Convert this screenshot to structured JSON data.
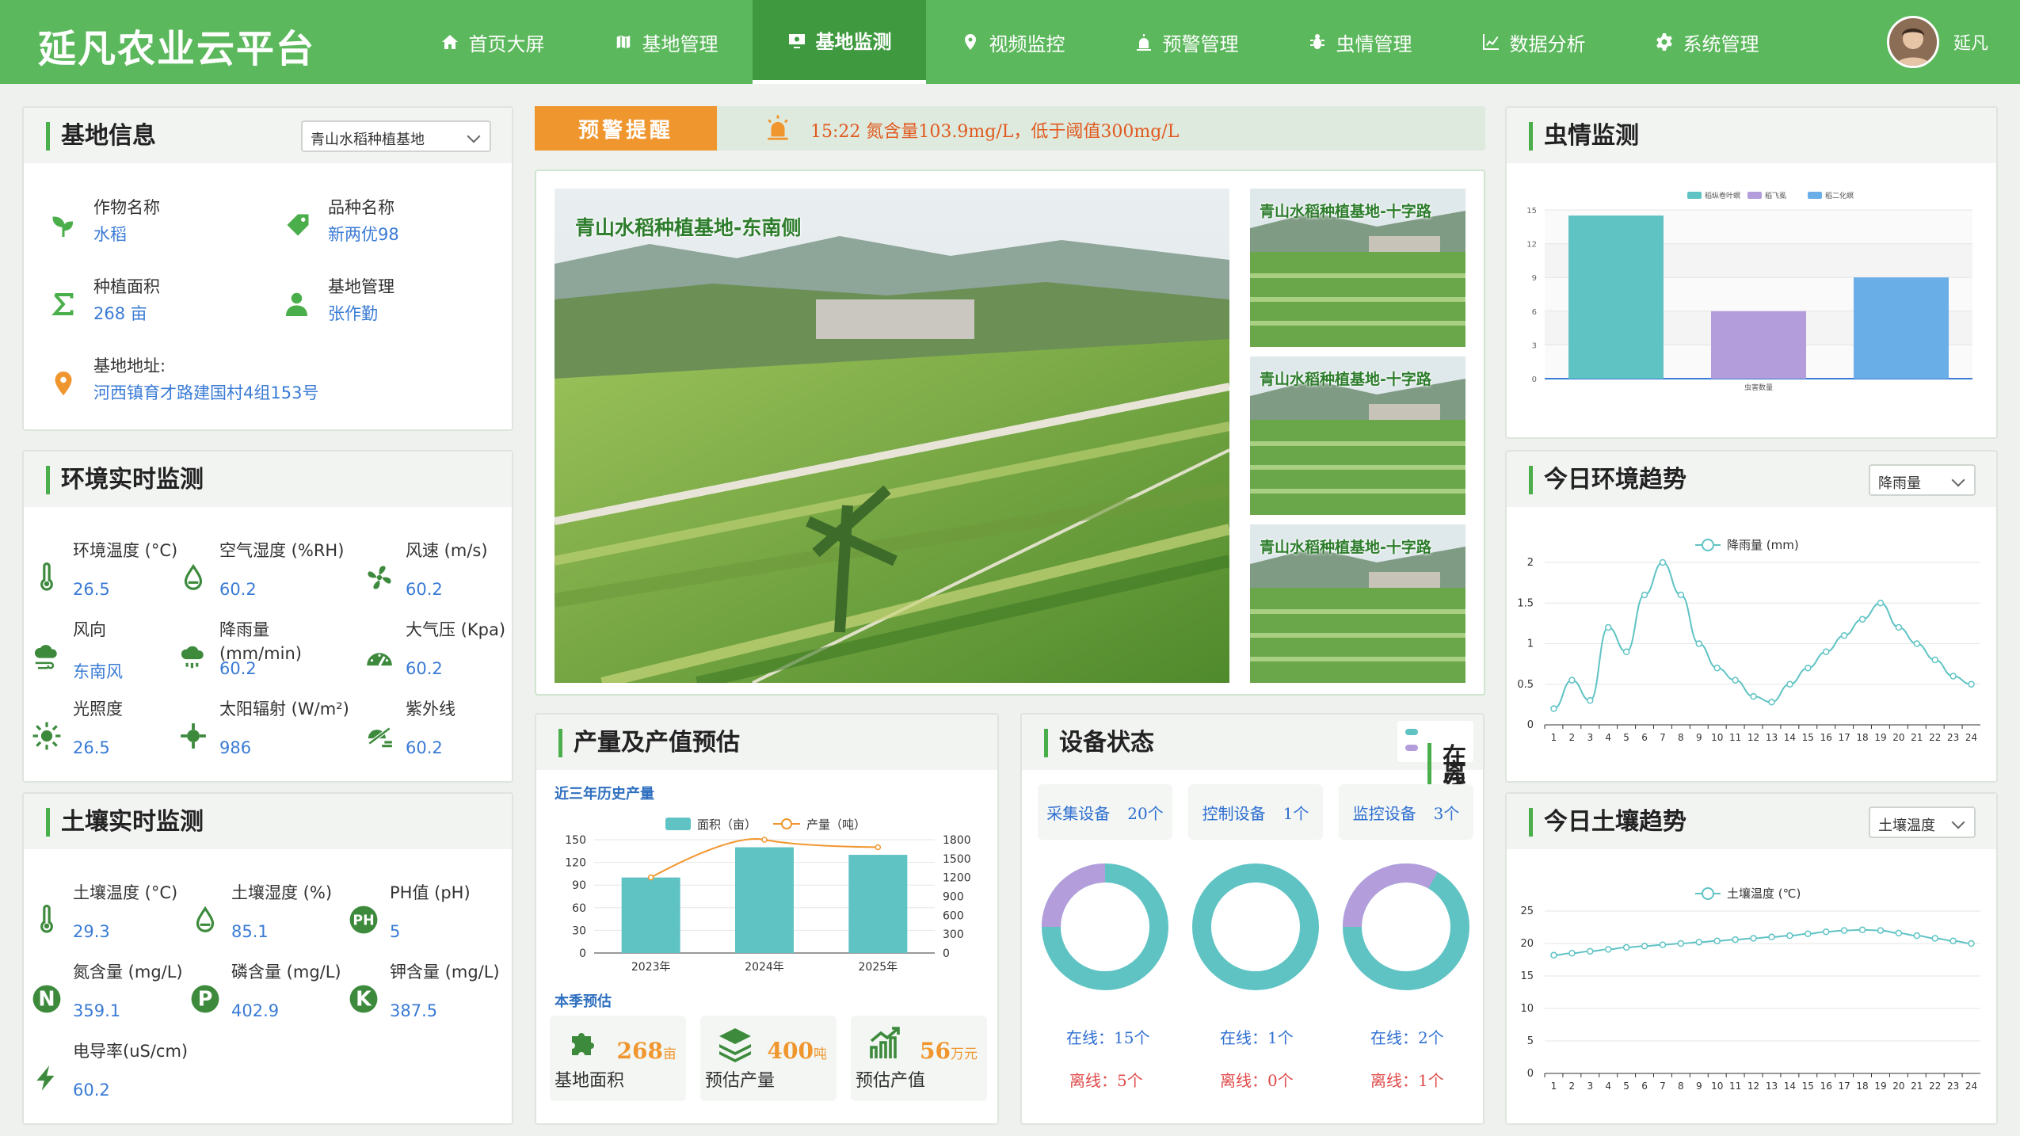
{
  "header": {
    "logo": "延凡农业云平台",
    "nav": [
      {
        "label": "首页大屏",
        "icon": "home-icon",
        "active": false
      },
      {
        "label": "基地管理",
        "icon": "map-icon",
        "active": false
      },
      {
        "label": "基地监测",
        "icon": "monitor-icon",
        "active": true
      },
      {
        "label": "视频监控",
        "icon": "location-pin-icon",
        "active": false
      },
      {
        "label": "预警管理",
        "icon": "alarm-icon",
        "active": false
      },
      {
        "label": "虫情管理",
        "icon": "bug-icon",
        "active": false
      },
      {
        "label": "数据分析",
        "icon": "chart-icon",
        "active": false
      },
      {
        "label": "系统管理",
        "icon": "gear-icon",
        "active": false
      }
    ],
    "user_name": "延凡"
  },
  "base_info": {
    "title": "基地信息",
    "selected_base": "青山水稻种植基地",
    "crop_label": "作物名称",
    "crop_value": "水稻",
    "variety_label": "品种名称",
    "variety_value": "新两优98",
    "area_label": "种植面积",
    "area_value": "268 亩",
    "manager_label": "基地管理",
    "manager_value": "张作勤",
    "address_label": "基地地址:",
    "address_value": "河西镇育才路建国村4组153号"
  },
  "env_realtime": {
    "title": "环境实时监测",
    "items": [
      {
        "label": "环境温度 (°C)",
        "value": "26.5",
        "icon": "thermometer-icon"
      },
      {
        "label": "空气湿度 (%RH)",
        "value": "60.2",
        "icon": "humidity-drop-icon"
      },
      {
        "label": "风速 (m/s)",
        "value": "60.2",
        "icon": "fan-icon"
      },
      {
        "label": "风向",
        "value": "东南风",
        "icon": "wind-cloud-icon"
      },
      {
        "label": "降雨量 (mm/min)",
        "value": "60.2",
        "icon": "rain-cloud-icon"
      },
      {
        "label": "大气压 (Kpa)",
        "value": "60.2",
        "icon": "gauge-icon"
      },
      {
        "label": "光照度",
        "value": "26.5",
        "icon": "sun-icon"
      },
      {
        "label": "太阳辐射 (W/m²)",
        "value": "986",
        "icon": "radiation-icon"
      },
      {
        "label": "紫外线",
        "value": "60.2",
        "icon": "uv-icon"
      }
    ]
  },
  "soil_realtime": {
    "title": "土壤实时监测",
    "items": [
      {
        "label": "土壤温度 (°C)",
        "value": "29.3",
        "icon": "thermometer-icon"
      },
      {
        "label": "土壤湿度 (%)",
        "value": "85.1",
        "icon": "humidity-drop-icon"
      },
      {
        "label": "PH值 (pH)",
        "value": "5",
        "icon": "ph-icon",
        "badge": "PH"
      },
      {
        "label": "氮含量 (mg/L)",
        "value": "359.1",
        "icon": "nitrogen-icon",
        "badge": "N"
      },
      {
        "label": "磷含量 (mg/L)",
        "value": "402.9",
        "icon": "phosphorus-icon",
        "badge": "P"
      },
      {
        "label": "钾含量 (mg/L)",
        "value": "387.5",
        "icon": "potassium-icon",
        "badge": "K"
      },
      {
        "label": "电导率(uS/cm)",
        "value": "60.2",
        "icon": "lightning-icon"
      }
    ]
  },
  "warning": {
    "tag": "预警提醒",
    "text": "15:22   氮含量103.9mg/L，低于阈值300mg/L"
  },
  "cameras": {
    "main_label": "青山水稻种植基地-东南侧",
    "side": [
      {
        "label": "青山水稻种植基地-十字路"
      },
      {
        "label": "青山水稻种植基地-十字路"
      },
      {
        "label": "青山水稻种植基地-十字路"
      }
    ]
  },
  "yield": {
    "title": "产量及产值预估",
    "history_label": "近三年历史产量",
    "season_label": "本季预估",
    "estimates": [
      {
        "num": "268",
        "unit": "亩",
        "name": "基地面积",
        "icon": "puzzle-icon"
      },
      {
        "num": "400",
        "unit": "吨",
        "name": "预估产量",
        "icon": "layers-icon"
      },
      {
        "num": "56",
        "unit": "万元",
        "name": "预估产值",
        "icon": "growth-chart-icon"
      }
    ]
  },
  "devices": {
    "title": "设备状态",
    "legend_online": "在线",
    "legend_offline": "离线",
    "online_color": "#5fc3c4",
    "offline_color": "#b39ddb",
    "groups": [
      {
        "name": "采集设备",
        "total": "20个",
        "online": 15,
        "offline": 5,
        "online_text": "在线：15个",
        "offline_text": "离线：5个"
      },
      {
        "name": "控制设备",
        "total": "1个",
        "online": 1,
        "offline": 0,
        "online_text": "在线：1个",
        "offline_text": "离线：0个"
      },
      {
        "name": "监控设备",
        "total": "3个",
        "online": 2,
        "offline": 1,
        "online_text": "在线：2个",
        "offline_text": "离线：1个"
      }
    ]
  },
  "pest": {
    "title": "虫情监测"
  },
  "env_trend": {
    "title": "今日环境趋势",
    "selected": "降雨量"
  },
  "soil_trend": {
    "title": "今日土壤趋势",
    "selected": "土壤温度"
  },
  "chart_data": [
    {
      "id": "yield_history",
      "type": "bar",
      "categories": [
        "2023年",
        "2024年",
        "2025年"
      ],
      "series": [
        {
          "name": "面积（亩）",
          "type": "bar",
          "axis": "left",
          "values": [
            100,
            140,
            130
          ],
          "color": "#5fc3c4"
        },
        {
          "name": "产量（吨）",
          "type": "line",
          "axis": "right",
          "values": [
            1200,
            1800,
            1680
          ],
          "color": "#f0962e"
        }
      ],
      "ylim_left": [
        0,
        150
      ],
      "yticks_left": [
        0,
        30,
        60,
        90,
        120,
        150
      ],
      "ylim_right": [
        0,
        1800
      ],
      "yticks_right": [
        0,
        300,
        600,
        900,
        1200,
        1500,
        1800
      ],
      "legend": "top-center"
    },
    {
      "id": "pest_monitor",
      "type": "bar",
      "categories": [
        "虫害数量"
      ],
      "series": [
        {
          "name": "稻纵卷叶螟",
          "values": [
            14.5
          ],
          "color": "#5fc3c4"
        },
        {
          "name": "稻飞虱",
          "values": [
            6
          ],
          "color": "#b39ddb"
        },
        {
          "name": "稻二化螟",
          "values": [
            9
          ],
          "color": "#6aaee8"
        }
      ],
      "ylim": [
        0,
        15
      ],
      "yticks": [
        0,
        3,
        6,
        9,
        12,
        15
      ],
      "legend": "top-center",
      "grid": true
    },
    {
      "id": "env_trend",
      "type": "line",
      "x": [
        "1",
        "2",
        "3",
        "4",
        "5",
        "6",
        "7",
        "8",
        "9",
        "10",
        "11",
        "12",
        "13",
        "14",
        "15",
        "16",
        "17",
        "18",
        "19",
        "20",
        "21",
        "22",
        "23",
        "24"
      ],
      "series": [
        {
          "name": "降雨量 (mm)",
          "values": [
            0.2,
            0.55,
            0.3,
            1.2,
            0.9,
            1.6,
            2.0,
            1.6,
            1.0,
            0.7,
            0.55,
            0.35,
            0.28,
            0.5,
            0.7,
            0.9,
            1.1,
            1.3,
            1.5,
            1.2,
            1.0,
            0.8,
            0.6,
            0.5
          ],
          "color": "#5fc3c4"
        }
      ],
      "ylim": [
        0,
        2
      ],
      "yticks": [
        0,
        0.5,
        1,
        1.5,
        2
      ],
      "legend": "top-center"
    },
    {
      "id": "soil_trend",
      "type": "line",
      "x": [
        "1",
        "2",
        "3",
        "4",
        "5",
        "6",
        "7",
        "8",
        "9",
        "10",
        "11",
        "12",
        "13",
        "14",
        "15",
        "16",
        "17",
        "18",
        "19",
        "20",
        "21",
        "22",
        "23",
        "24"
      ],
      "series": [
        {
          "name": "土壤温度 (℃)",
          "values": [
            18.2,
            18.5,
            18.8,
            19.1,
            19.4,
            19.6,
            19.8,
            20.0,
            20.2,
            20.4,
            20.6,
            20.8,
            21.0,
            21.2,
            21.5,
            21.8,
            22.0,
            22.1,
            22.0,
            21.6,
            21.2,
            20.8,
            20.4,
            20.0
          ],
          "color": "#5fc3c4"
        }
      ],
      "ylim": [
        0,
        25
      ],
      "yticks": [
        0,
        5,
        10,
        15,
        20,
        25
      ],
      "legend": "top-center"
    }
  ]
}
